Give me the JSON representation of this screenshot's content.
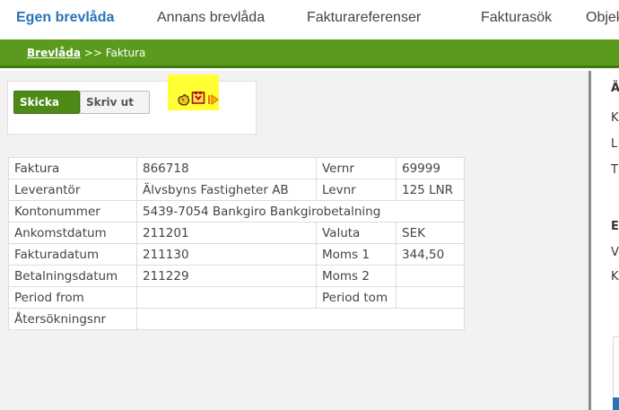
{
  "nav": {
    "tabs": [
      {
        "label": "Egen brevlåda",
        "active": true
      },
      {
        "label": "Annans brevlåda",
        "active": false
      },
      {
        "label": "Fakturareferenser",
        "active": false
      },
      {
        "label": "Fakturasök",
        "active": false
      },
      {
        "label": "Objek",
        "active": false
      }
    ]
  },
  "breadcrumb": {
    "link": "Brevlåda",
    "separator": ">>",
    "current": "Faktura"
  },
  "toolbar": {
    "send_label": "Skicka",
    "print_label": "Skriv ut",
    "icons": [
      "hand-icon",
      "document-icon",
      "arrow-right-icon"
    ]
  },
  "invoice": {
    "rows": [
      [
        "Faktura",
        "866718",
        "Vernr",
        "69999"
      ],
      [
        "Leverantör",
        "Älvsbyns Fastigheter AB",
        "Levnr",
        "125 LNR"
      ],
      [
        "Kontonummer",
        "5439-7054  Bankgiro Bankgirobetalning"
      ],
      [
        "Ankomstdatum",
        "211201",
        "Valuta",
        "SEK"
      ],
      [
        "Fakturadatum",
        "211130",
        "Moms 1",
        "344,50"
      ],
      [
        "Betalningsdatum",
        "211229",
        "Moms 2",
        ""
      ],
      [
        "Period from",
        "",
        "Period tom",
        ""
      ],
      [
        "Återsökningsnr",
        ""
      ]
    ]
  },
  "right_panel": {
    "lines": [
      "Ä",
      "K",
      "L",
      "T",
      "E",
      "V",
      "K"
    ]
  },
  "colors": {
    "nav_active": "#2a73b8",
    "breadcrumb_bar": "#5a9b1e",
    "send_button": "#4e8a16",
    "highlight": "#ffff33"
  }
}
